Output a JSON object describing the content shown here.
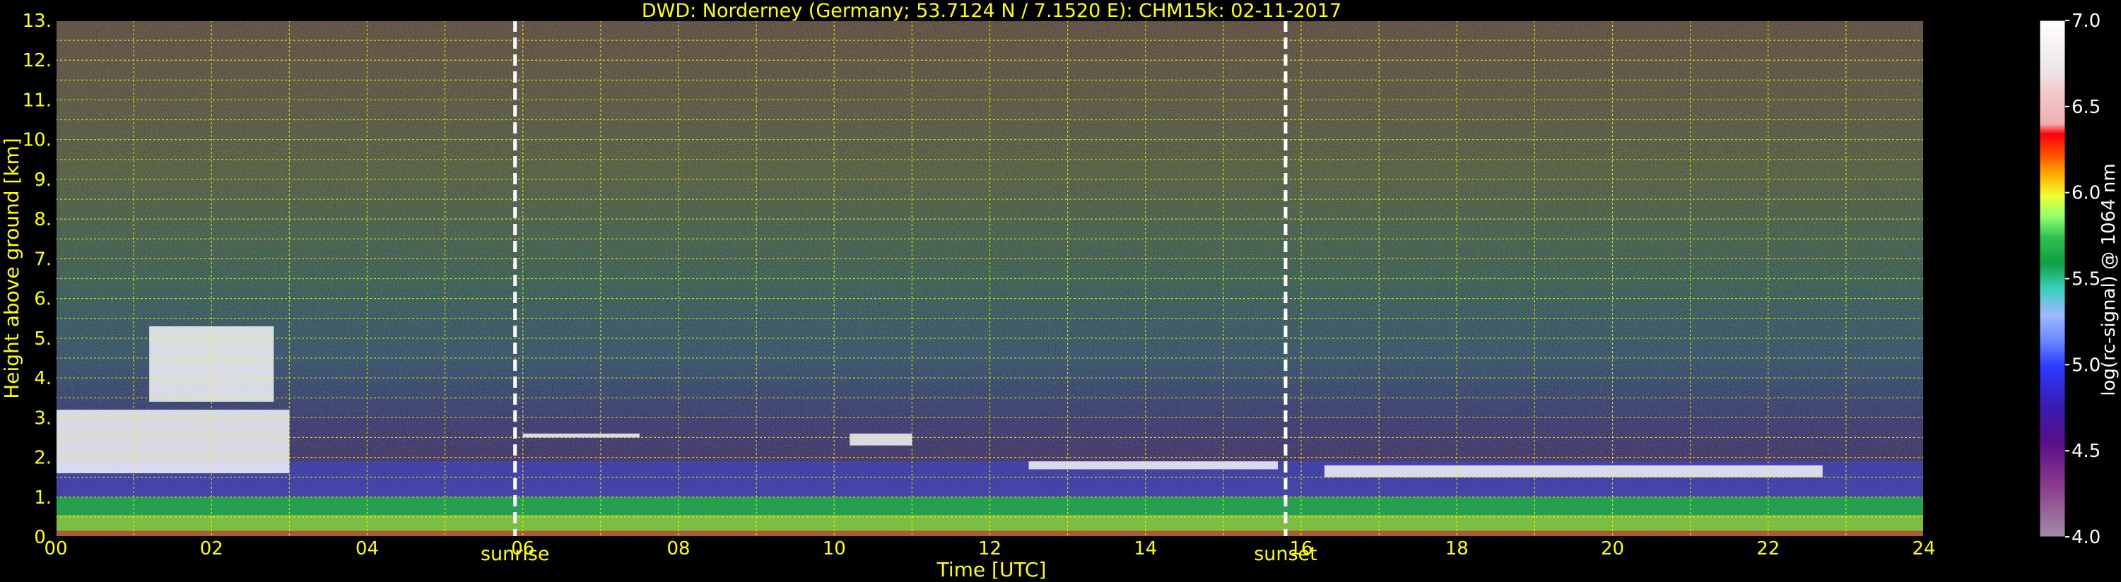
{
  "chart_data": {
    "type": "heatmap",
    "title": "DWD: Norderney (Germany; 53.7124 N / 7.1520 E):    CHM15k: 02-11-2017",
    "xlabel": "Time [UTC]",
    "ylabel": "Height above ground [km]",
    "xlim": [
      0,
      24
    ],
    "ylim": [
      0,
      13
    ],
    "x_ticks": [
      "00",
      "02",
      "04",
      "06",
      "08",
      "10",
      "12",
      "14",
      "16",
      "18",
      "20",
      "22",
      "24"
    ],
    "y_ticks": [
      "0.",
      "1.",
      "2.",
      "3.",
      "4.",
      "5.",
      "6.",
      "7.",
      "8.",
      "9.",
      "10.",
      "11.",
      "12.",
      "13."
    ],
    "grid": true,
    "colorbar": {
      "label": "log(rc-signal) @ 1064 nm",
      "range": [
        4.0,
        7.0
      ],
      "ticks": [
        "4.0",
        "4.5",
        "5.0",
        "5.5",
        "6.0",
        "6.5",
        "7.0"
      ]
    },
    "markers": [
      {
        "name": "sunrise",
        "x": 5.9
      },
      {
        "name": "sunset",
        "x": 15.8
      }
    ]
  },
  "colors": {
    "background": "#000000",
    "text": "#ffff00",
    "grid": "#ffff00",
    "marker_line": "#ffffff"
  }
}
